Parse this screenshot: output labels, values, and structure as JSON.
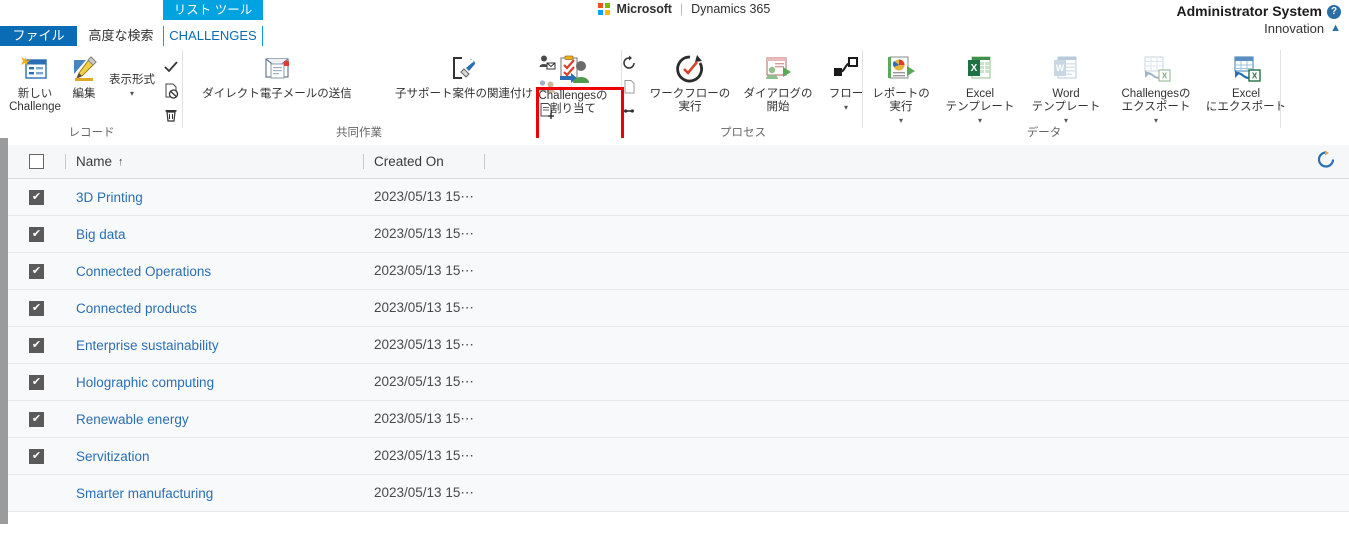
{
  "header": {
    "brand_microsoft": "Microsoft",
    "brand_separator": "|",
    "brand_product": "Dynamics 365",
    "user_name": "Administrator System",
    "org_name": "Innovation",
    "help_icon": "help-question-icon",
    "chevron_icon": "chevron-up-icon"
  },
  "tabs": {
    "contextual_group_label": "リスト ツール",
    "items": [
      {
        "label": "ファイル",
        "active": true
      },
      {
        "label": "高度な検索",
        "active": false
      },
      {
        "label": "CHALLENGES",
        "active": false,
        "contextual": true
      }
    ]
  },
  "ribbon": {
    "groups": [
      {
        "name": "record",
        "label": "レコード",
        "buttons": [
          {
            "label": "新しい\nChallenge",
            "icon": "new-record-icon"
          },
          {
            "label": "編集",
            "icon": "edit-pencil-icon"
          },
          {
            "label": "表示形式",
            "icon": "view-format-icon",
            "has_caret": true
          }
        ],
        "small_buttons": [
          {
            "icon": "activate-check-icon"
          },
          {
            "icon": "deactivate-icon"
          },
          {
            "icon": "delete-trash-icon"
          }
        ]
      },
      {
        "name": "collaborate",
        "label": "共同作業",
        "buttons": [
          {
            "label": "ダイレクト電子メールの送信",
            "icon": "direct-email-icon"
          },
          {
            "label": "子サポート案件の関連付け",
            "icon": "connect-case-icon"
          },
          {
            "label": "Challengesの\n割り当て",
            "icon": "assign-challenges-icon",
            "highlighted": true
          }
        ],
        "small_buttons": [
          {
            "icon": "add-contact-icon"
          },
          {
            "icon": "share-team-icon",
            "has_caret": true
          },
          {
            "icon": "add-note-icon"
          }
        ]
      },
      {
        "name": "process",
        "label": "プロセス",
        "buttons": [
          {
            "label": "ワークフローの\n実行",
            "icon": "run-workflow-icon"
          },
          {
            "label": "ダイアログの\n開始",
            "icon": "start-dialog-icon"
          },
          {
            "label": "フロー",
            "icon": "flow-icon",
            "has_caret": true
          }
        ],
        "small_buttons": [
          {
            "icon": "refresh-circle-icon"
          },
          {
            "icon": "document-icon"
          },
          {
            "icon": "link-icon"
          }
        ]
      },
      {
        "name": "data",
        "label": "データ",
        "buttons": [
          {
            "label": "レポートの\n実行",
            "icon": "run-report-icon",
            "has_caret": true
          },
          {
            "label": "Excel\nテンプレート",
            "icon": "excel-template-icon",
            "has_caret": true
          },
          {
            "label": "Word\nテンプレート",
            "icon": "word-template-icon",
            "has_caret": true
          },
          {
            "label": "Challengesの\nエクスポート",
            "icon": "export-challenges-icon",
            "has_caret": true
          },
          {
            "label": "Excel\nにエクスポート",
            "icon": "export-excel-icon"
          }
        ],
        "small_buttons": []
      }
    ]
  },
  "grid": {
    "select_all_checked": false,
    "refresh_icon": "refresh-spinner-icon",
    "columns": [
      {
        "key": "name",
        "label": "Name",
        "sorted": true,
        "sort_direction": "↑"
      },
      {
        "key": "created_on",
        "label": "Created On",
        "sorted": false
      }
    ],
    "rows": [
      {
        "checked": true,
        "name": "3D Printing",
        "created_on": "2023/05/13 15⋯"
      },
      {
        "checked": true,
        "name": "Big data",
        "created_on": "2023/05/13 15⋯"
      },
      {
        "checked": true,
        "name": "Connected Operations",
        "created_on": "2023/05/13 15⋯"
      },
      {
        "checked": true,
        "name": "Connected products",
        "created_on": "2023/05/13 15⋯"
      },
      {
        "checked": true,
        "name": "Enterprise sustainability",
        "created_on": "2023/05/13 15⋯"
      },
      {
        "checked": true,
        "name": "Holographic computing",
        "created_on": "2023/05/13 15⋯"
      },
      {
        "checked": true,
        "name": "Renewable energy",
        "created_on": "2023/05/13 15⋯"
      },
      {
        "checked": true,
        "name": "Servitization",
        "created_on": "2023/05/13 15⋯"
      },
      {
        "checked": false,
        "name": "Smarter manufacturing",
        "created_on": "2023/05/13 15⋯"
      }
    ]
  },
  "colors": {
    "tab_active": "#0a6cb4",
    "contextual": "#00a3e0",
    "link": "#2a6fb5",
    "highlight": "#ee0000",
    "row_bg": "#f8f9fa"
  }
}
